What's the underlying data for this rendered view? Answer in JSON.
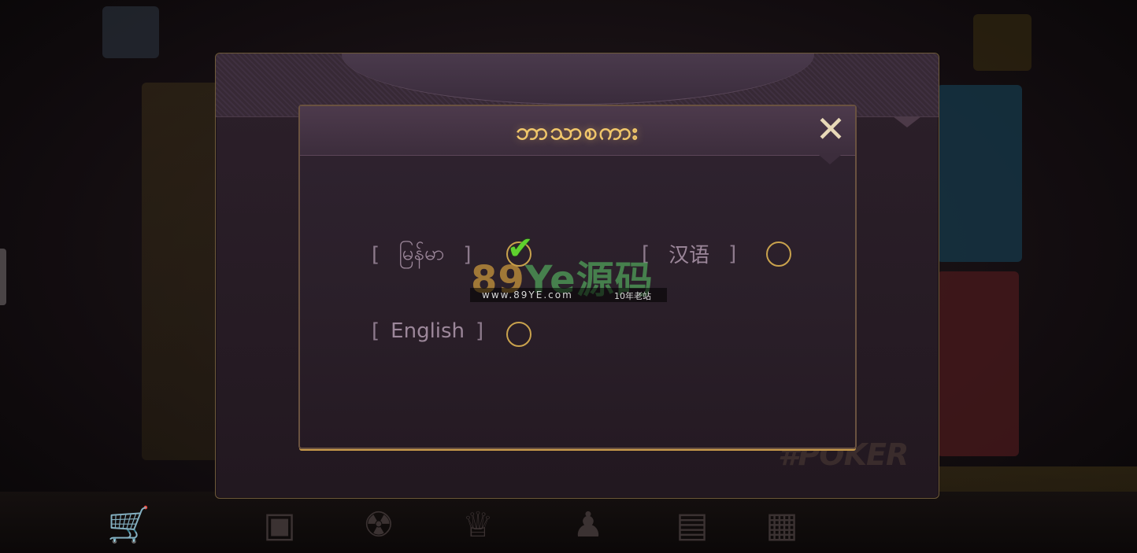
{
  "dialog": {
    "title": "ဘာသာစကား",
    "close_glyph": "✕"
  },
  "languages": [
    {
      "label": "မြန်မာ",
      "selected": true
    },
    {
      "label": "汉语",
      "selected": false
    },
    {
      "label": "English",
      "selected": false
    }
  ],
  "brackets": {
    "open": "[",
    "close": "]"
  },
  "check_glyph": "✔",
  "background": {
    "logo_text": "#POKER"
  },
  "watermark": {
    "logo": "89Ye源码",
    "logo_main": "89",
    "logo_accent": "Ye源码",
    "url": "www.89YE.com",
    "subtitle": "10年老站"
  },
  "colors": {
    "title_gold": "#f0c66a",
    "radio_border": "#c9a24d",
    "check_green": "#5fd12e",
    "label_muted": "#9c879a"
  }
}
